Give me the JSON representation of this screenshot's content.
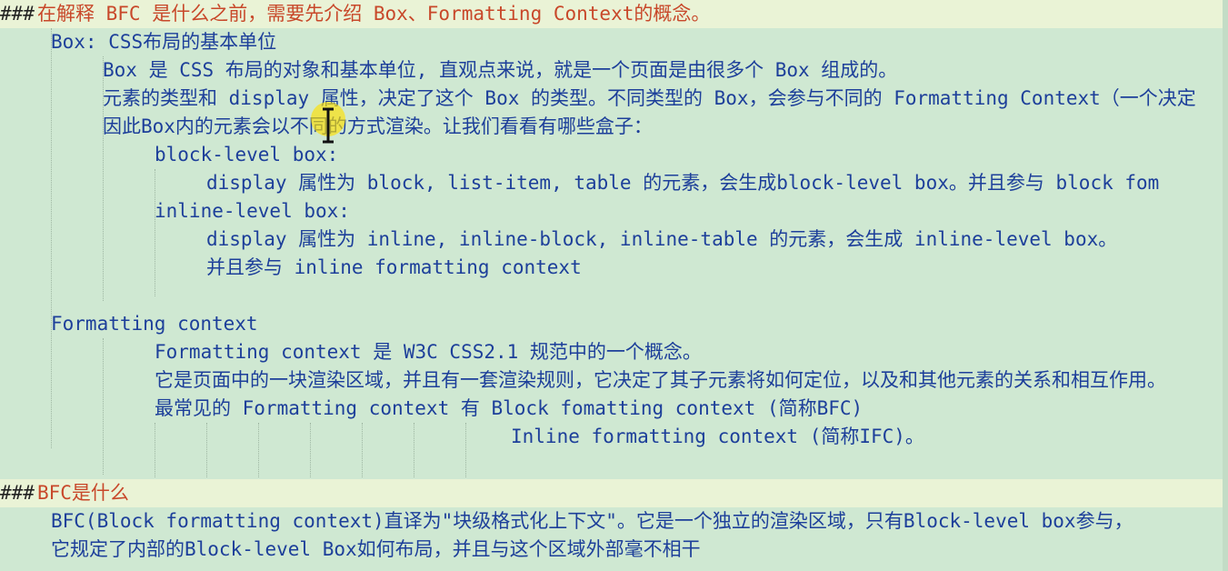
{
  "lines": [
    {
      "id": "l1",
      "hash": "###",
      "text": "在解释 BFC 是什么之前，需要先介绍 Box、Formatting Context的概念。",
      "heading": true
    },
    {
      "id": "l2",
      "text": "Box: CSS布局的基本单位"
    },
    {
      "id": "l3",
      "text": "Box 是 CSS 布局的对象和基本单位, 直观点来说，就是一个页面是由很多个 Box 组成的。"
    },
    {
      "id": "l4",
      "text": "元素的类型和 display 属性，决定了这个 Box 的类型。不同类型的 Box，会参与不同的 Formatting Context（一个决定"
    },
    {
      "id": "l5",
      "text": "因此Box内的元素会以不同的方式渲染。让我们看看有哪些盒子："
    },
    {
      "id": "l6",
      "text": "block-level box:"
    },
    {
      "id": "l7",
      "text": "display 属性为 block, list-item, table 的元素，会生成block-level box。并且参与 block fom"
    },
    {
      "id": "l8",
      "text": "inline-level box:"
    },
    {
      "id": "l9",
      "text": "display 属性为 inline, inline-block, inline-table 的元素，会生成 inline-level box。"
    },
    {
      "id": "l10",
      "text": "并且参与 inline formatting context"
    },
    {
      "id": "l11",
      "text": "Formatting context"
    },
    {
      "id": "l12",
      "text": "Formatting context 是 W3C CSS2.1 规范中的一个概念。"
    },
    {
      "id": "l13",
      "text": "它是页面中的一块渲染区域，并且有一套渲染规则，它决定了其子元素将如何定位，以及和其他元素的关系和相互作用。"
    },
    {
      "id": "l14",
      "text": "最常见的 Formatting context 有 Block fomatting context (简称BFC)"
    },
    {
      "id": "l15",
      "text": "Inline formatting context (简称IFC)。"
    },
    {
      "id": "l16",
      "hash": "###",
      "text": "BFC是什么",
      "heading": true
    },
    {
      "id": "l17",
      "text": "BFC(Block formatting context)直译为\"块级格式化上下文\"。它是一个独立的渲染区域，只有Block-level box参与，"
    },
    {
      "id": "l18",
      "text": "它规定了内部的Block-level Box如何布局，并且与这个区域外部毫不相干"
    }
  ]
}
